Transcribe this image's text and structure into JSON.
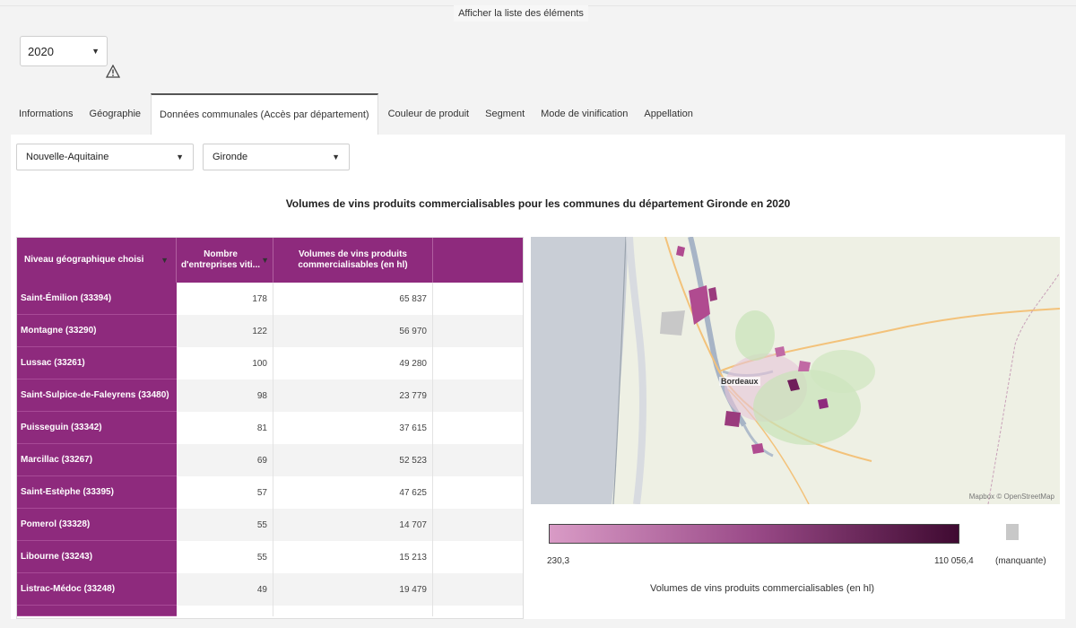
{
  "top_link": "Afficher la liste des éléments",
  "year_select": {
    "value": "2020"
  },
  "tabs": [
    {
      "label": "Informations"
    },
    {
      "label": "Géographie"
    },
    {
      "label": "Données communales (Accès par département)",
      "active": true
    },
    {
      "label": "Couleur de produit"
    },
    {
      "label": "Segment"
    },
    {
      "label": "Mode de vinification"
    },
    {
      "label": "Appellation"
    }
  ],
  "filters": {
    "region": "Nouvelle-Aquitaine",
    "department": "Gironde"
  },
  "title": "Volumes de vins produits commercialisables pour les communes du département Gironde en 2020",
  "table": {
    "headers": [
      "Niveau géographique choisi",
      "Nombre d'entreprises viti...",
      "Volumes de vins produits commercialisables (en hl)"
    ],
    "rows": [
      {
        "commune": "Saint-Émilion (33394)",
        "entreprises": "178",
        "volume": "65 837"
      },
      {
        "commune": "Montagne (33290)",
        "entreprises": "122",
        "volume": "56 970"
      },
      {
        "commune": "Lussac (33261)",
        "entreprises": "100",
        "volume": "49 280"
      },
      {
        "commune": "Saint-Sulpice-de-Faleyrens (33480)",
        "entreprises": "98",
        "volume": "23 779"
      },
      {
        "commune": "Puisseguin (33342)",
        "entreprises": "81",
        "volume": "37 615"
      },
      {
        "commune": "Marcillac (33267)",
        "entreprises": "69",
        "volume": "52 523"
      },
      {
        "commune": "Saint-Estèphe (33395)",
        "entreprises": "57",
        "volume": "47 625"
      },
      {
        "commune": "Pomerol (33328)",
        "entreprises": "55",
        "volume": "14 707"
      },
      {
        "commune": "Libourne (33243)",
        "entreprises": "55",
        "volume": "15 213"
      },
      {
        "commune": "Listrac-Médoc (33248)",
        "entreprises": "49",
        "volume": "19 479"
      }
    ]
  },
  "map": {
    "city_label": "Bordeaux",
    "attribution": "Mapbox © OpenStreetMap"
  },
  "legend": {
    "min": "230,3",
    "max": "110 056,4",
    "missing": "(manquante)",
    "title": "Volumes de vins produits commercialisables (en hl)",
    "color_start": "#d99bc6",
    "color_end": "#3f0a31",
    "missing_color": "#c8c8c8"
  },
  "colors": {
    "accent": "#8e2a7d"
  },
  "icons": {
    "warning": "warning-icon",
    "caret": "caret-down-icon"
  }
}
